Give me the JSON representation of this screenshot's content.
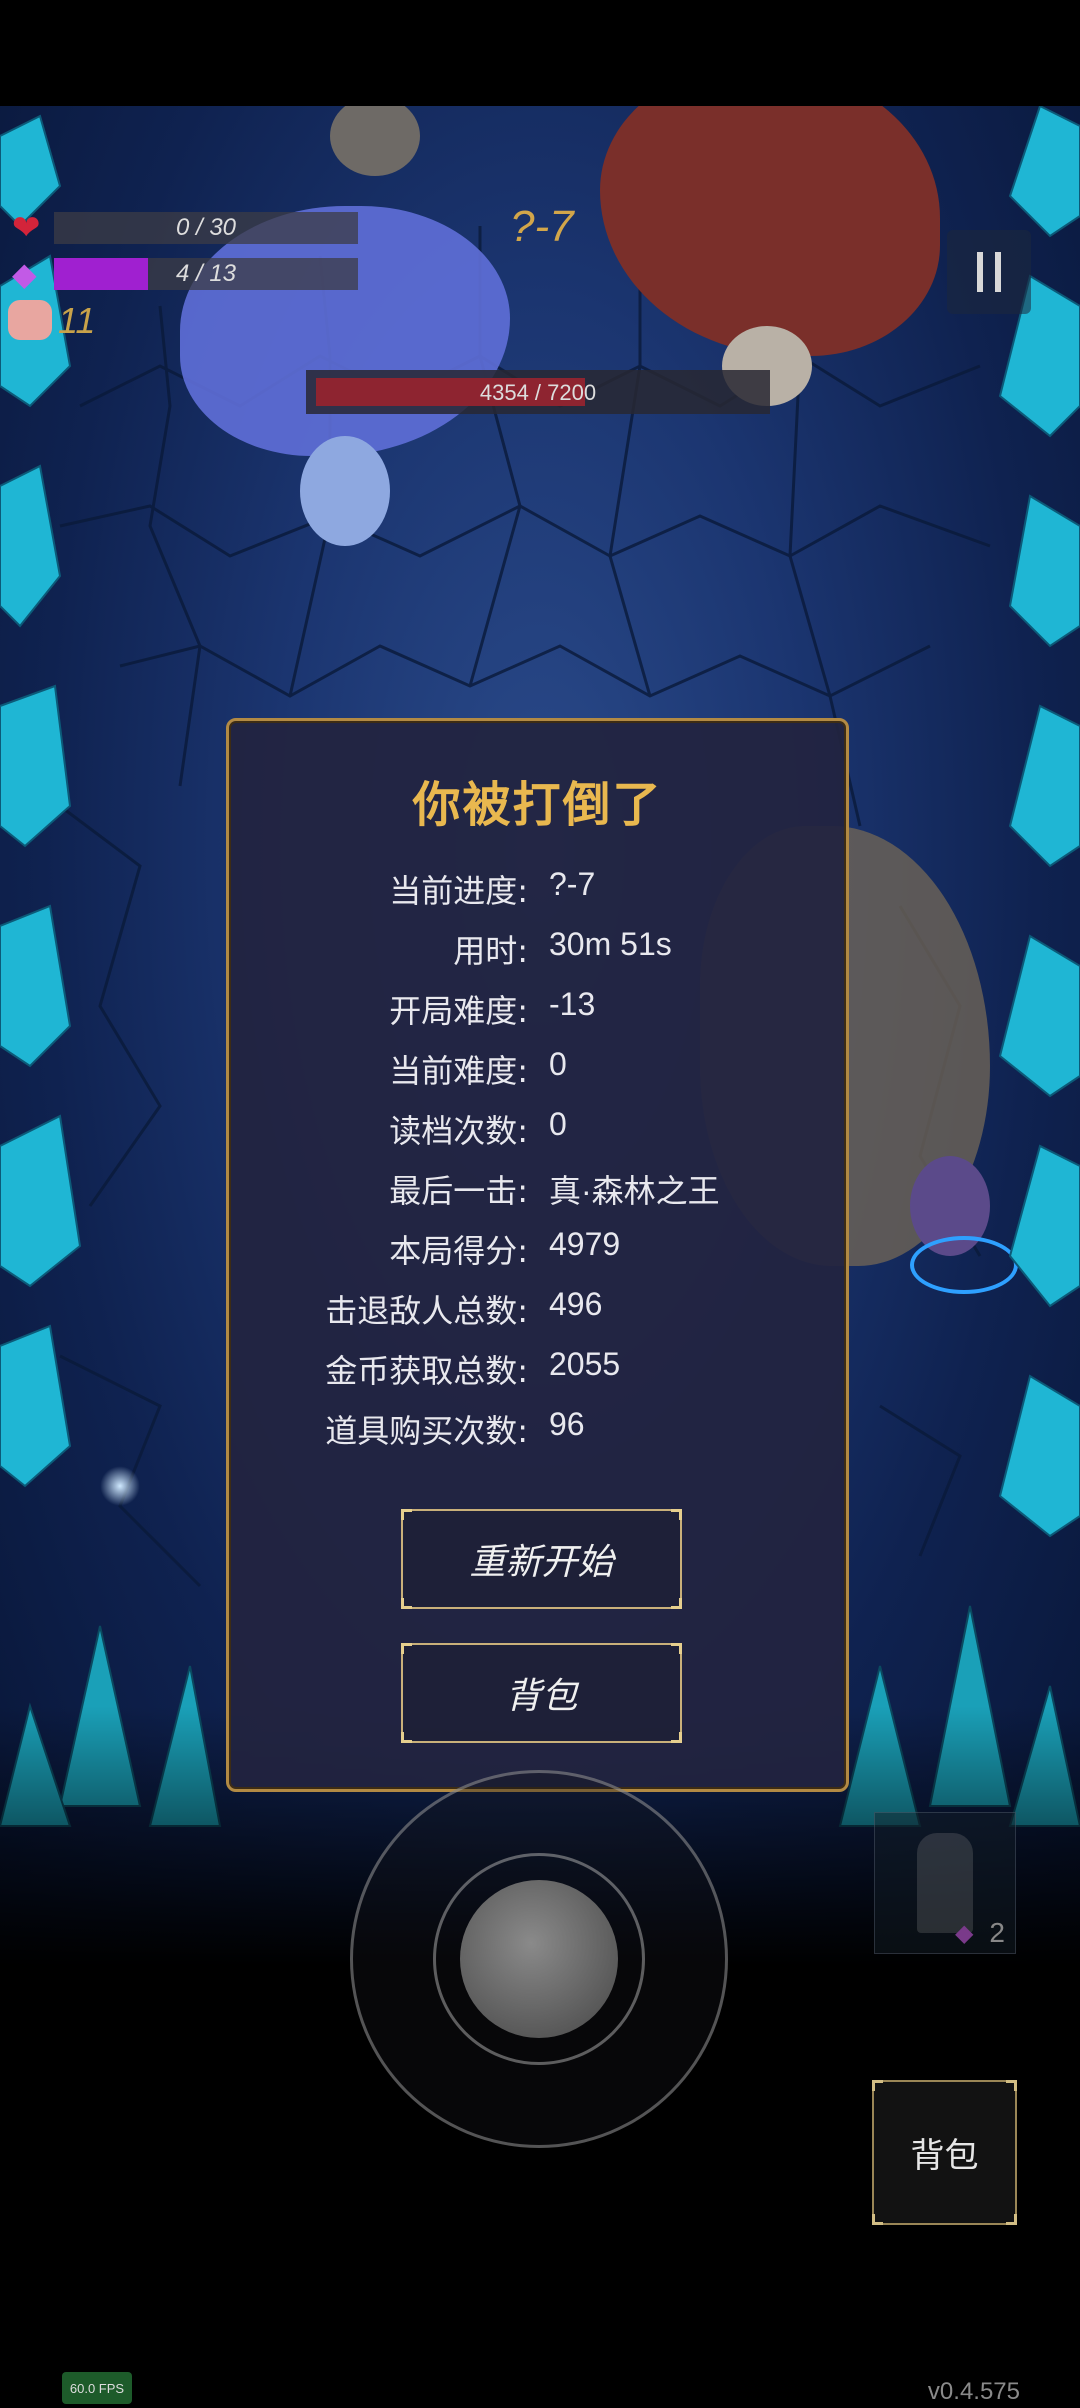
{
  "hud": {
    "hp_text": "0 / 30",
    "hp_fraction": 0.0,
    "mana_text": "4 / 13",
    "mana_fraction": 0.31,
    "coins": "11",
    "stage": "?-7",
    "hp_icon": "heart-icon",
    "mana_icon": "crystal-icon",
    "coin_icon": "pig-icon",
    "pause_icon": "pause-icon"
  },
  "boss": {
    "hp_text": "4354 / 7200",
    "hp_fraction": 0.605
  },
  "dialog": {
    "title": "你被打倒了",
    "stats": [
      {
        "label": "当前进度:",
        "value": "?-7"
      },
      {
        "label": "用时:",
        "value": "30m 51s"
      },
      {
        "label": "开局难度:",
        "value": "-13"
      },
      {
        "label": "当前难度:",
        "value": "0"
      },
      {
        "label": "读档次数:",
        "value": "0"
      },
      {
        "label": "最后一击:",
        "value": "真·森林之王"
      },
      {
        "label": "本局得分:",
        "value": "4979"
      },
      {
        "label": "击退敌人总数:",
        "value": "496"
      },
      {
        "label": "金币获取总数:",
        "value": "2055"
      },
      {
        "label": "道具购买次数:",
        "value": "96"
      }
    ],
    "restart_label": "重新开始",
    "bag_label": "背包"
  },
  "controls": {
    "bag_label": "背包",
    "skill_count": "2"
  },
  "footer": {
    "fps": "60.0 FPS",
    "version": "v0.4.575"
  },
  "colors": {
    "title": "#e9b84f",
    "stage": "#d2a64a",
    "mana": "#a020d0",
    "boss_hp": "#8e2430",
    "dialog_border": "#b28a44"
  }
}
